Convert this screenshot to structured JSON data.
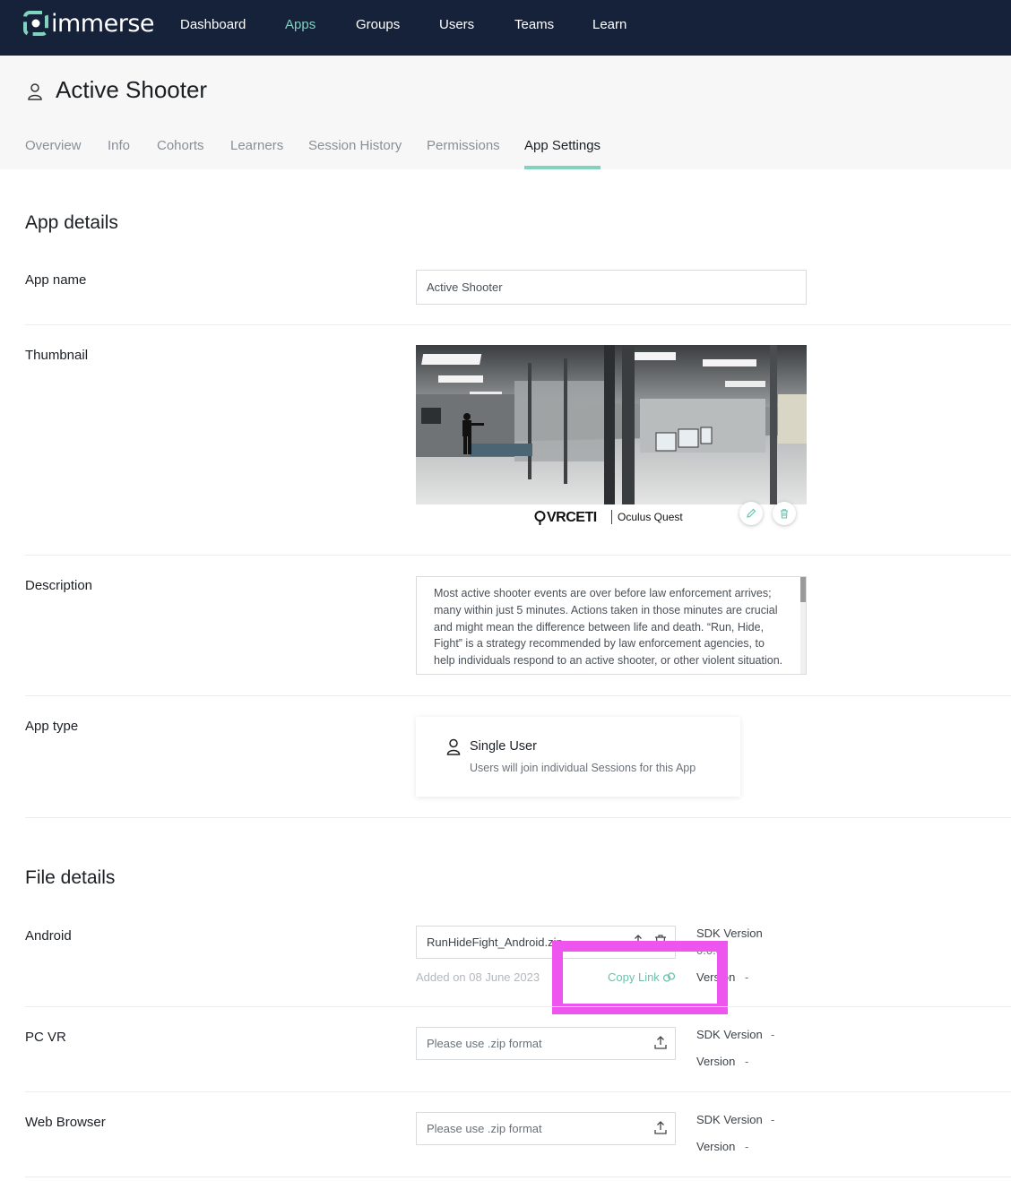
{
  "nav": {
    "logo_text": "immerse",
    "items": [
      {
        "label": "Dashboard",
        "active": false
      },
      {
        "label": "Apps",
        "active": true
      },
      {
        "label": "Groups",
        "active": false
      },
      {
        "label": "Users",
        "active": false
      },
      {
        "label": "Teams",
        "active": false
      },
      {
        "label": "Learn",
        "active": false
      }
    ],
    "accent_color": "#7fd3bf",
    "background_color": "#16223a"
  },
  "header": {
    "title": "Active Shooter",
    "tabs": [
      {
        "label": "Overview",
        "active": false
      },
      {
        "label": "Info",
        "active": false
      },
      {
        "label": "Cohorts",
        "active": false
      },
      {
        "label": "Learners",
        "active": false
      },
      {
        "label": "Session History",
        "active": false
      },
      {
        "label": "Permissions",
        "active": false
      },
      {
        "label": "App Settings",
        "active": true
      }
    ]
  },
  "app_details": {
    "section_title": "App details",
    "app_name": {
      "label": "App name",
      "value": "Active Shooter"
    },
    "thumbnail": {
      "label": "Thumbnail",
      "brand": "VRCETI",
      "platform": "Oculus Quest",
      "edit_icon": "pencil-icon",
      "delete_icon": "trash-icon"
    },
    "description": {
      "label": "Description",
      "value": "Most active shooter events are over before law enforcement arrives; many within just 5 minutes. Actions taken in those minutes are crucial and might mean the difference between life and death. “Run, Hide, Fight” is a strategy recommended by law enforcement agencies, to help individuals respond to an active shooter, or other violent situation."
    },
    "app_type": {
      "label": "App type",
      "title": "Single User",
      "subtitle": "Users will join individual Sessions for this App",
      "icon": "user-icon"
    }
  },
  "file_details": {
    "section_title": "File details",
    "files": [
      {
        "label": "Android",
        "value": "RunHideFight_Android.zip",
        "placeholder": "",
        "sdk_label": "SDK Version",
        "sdk_value": "0.0.0",
        "version_label": "Version",
        "version_value": "-",
        "added": "Added on 08 June 2023",
        "copy_link": "Copy Link"
      },
      {
        "label": "PC VR",
        "value": "",
        "placeholder": "Please use .zip format",
        "sdk_label": "SDK Version",
        "sdk_value": "-",
        "version_label": "Version",
        "version_value": "-"
      },
      {
        "label": "Web Browser",
        "value": "",
        "placeholder": "Please use .zip format",
        "sdk_label": "SDK Version",
        "sdk_value": "-",
        "version_label": "Version",
        "version_value": "-"
      }
    ]
  },
  "highlight_color": "#ee55ee"
}
